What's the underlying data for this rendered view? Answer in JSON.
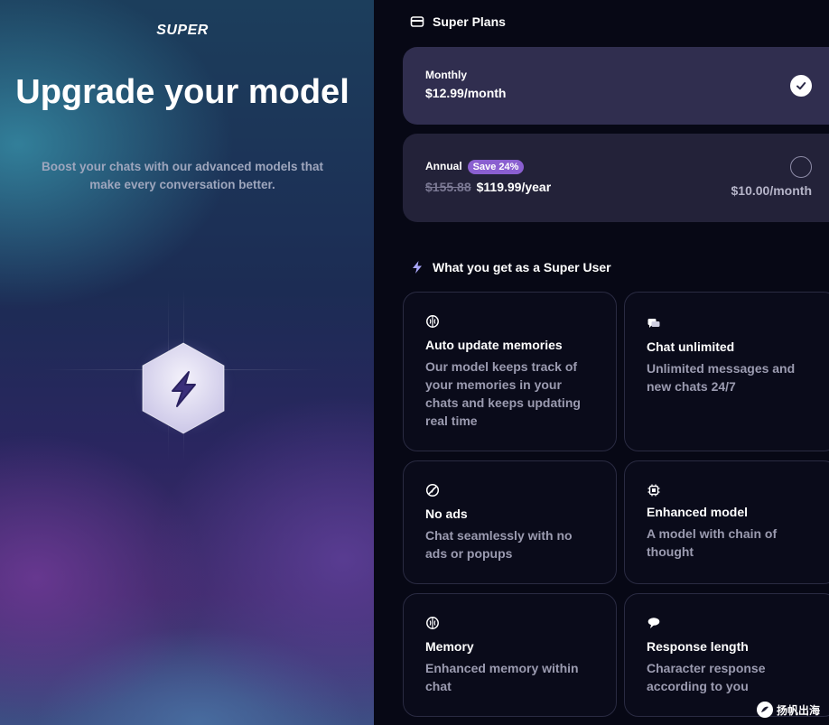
{
  "hero": {
    "brand": "SUPER",
    "headline": "Upgrade your model",
    "subtitle": "Boost your chats with our advanced models that make every conversation better.",
    "icon": "lightning-hexagon-icon"
  },
  "plans_section": {
    "title": "Super Plans",
    "icon": "card-icon",
    "plans": [
      {
        "name": "Monthly",
        "price": "$12.99/month",
        "selected": true
      },
      {
        "name": "Annual",
        "badge": "Save 24%",
        "old_price": "$155.88",
        "price": "$119.99/year",
        "per_month": "$10.00/month",
        "selected": false
      }
    ]
  },
  "features_section": {
    "title": "What you get as a Super User",
    "icon": "lightning-icon",
    "features": [
      {
        "icon": "brain-icon",
        "title": "Auto update memories",
        "desc": "Our model keeps track of your memories in your chats and keeps updating real time"
      },
      {
        "icon": "chat-bubbles-icon",
        "title": "Chat unlimited",
        "desc": "Unlimited messages and new chats 24/7"
      },
      {
        "icon": "no-ads-icon",
        "title": "No ads",
        "desc": "Chat seamlessly with no ads or popups"
      },
      {
        "icon": "cpu-chip-icon",
        "title": "Enhanced model",
        "desc": "A model with chain of thought"
      },
      {
        "icon": "brain-icon",
        "title": "Memory",
        "desc": "Enhanced memory within chat"
      },
      {
        "icon": "speech-bubble-icon",
        "title": "Response length",
        "desc": "Character response according to you"
      }
    ]
  },
  "watermark": "扬帆出海",
  "colors": {
    "accent": "#8a5fd0",
    "panel_bg": "#070815",
    "card_bg": "#0a0b1a"
  }
}
